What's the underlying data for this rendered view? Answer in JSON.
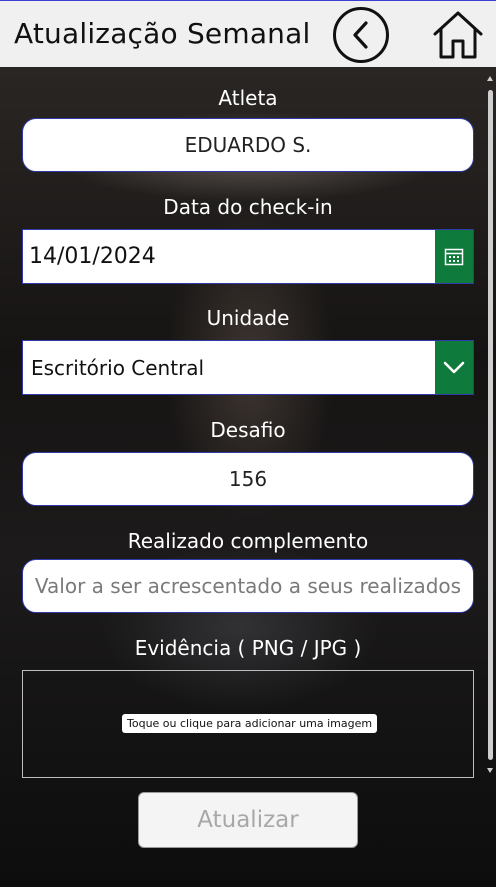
{
  "header": {
    "title": "Atualização Semanal",
    "back_icon": "chevron-left-circle-icon",
    "home_icon": "home-icon"
  },
  "form": {
    "athlete": {
      "label": "Atleta",
      "value": "EDUARDO S."
    },
    "checkin_date": {
      "label": "Data do check-in",
      "value": "14/01/2024",
      "icon": "calendar-icon"
    },
    "unit": {
      "label": "Unidade",
      "value": "Escritório Central",
      "icon": "chevron-down-icon"
    },
    "challenge": {
      "label": "Desafio",
      "value": "156"
    },
    "complement": {
      "label": "Realizado complemento",
      "placeholder": "Valor a ser acrescentado a seus realizados"
    },
    "evidence": {
      "label": "Evidência ( PNG / JPG )",
      "hint": "Toque ou clique para adicionar uma imagem"
    },
    "submit_label": "Atualizar"
  },
  "colors": {
    "accent_green": "#0e7a3b",
    "border_blue": "#2f3aa8",
    "header_bg": "#f0f0f0"
  }
}
